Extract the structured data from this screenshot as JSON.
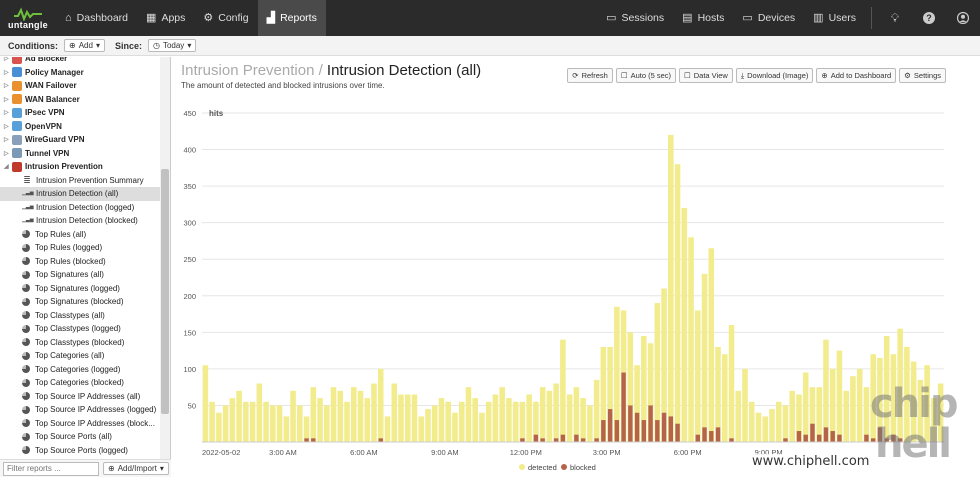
{
  "app": {
    "logo_text": "untangle",
    "nav": [
      {
        "label": "Dashboard",
        "icon": "home-icon"
      },
      {
        "label": "Apps",
        "icon": "grid-icon"
      },
      {
        "label": "Config",
        "icon": "gear-icon"
      },
      {
        "label": "Reports",
        "icon": "chart-icon"
      }
    ],
    "nav_right": [
      {
        "label": "Sessions",
        "icon": "sessions-icon"
      },
      {
        "label": "Hosts",
        "icon": "hosts-icon"
      },
      {
        "label": "Devices",
        "icon": "devices-icon"
      },
      {
        "label": "Users",
        "icon": "users-icon"
      }
    ]
  },
  "conditions": {
    "label": "Conditions:",
    "add_label": "Add",
    "since_label": "Since:",
    "since_value": "Today"
  },
  "sidebar": {
    "apps": [
      {
        "label": "Ad Blocker",
        "color": "#d9534f"
      },
      {
        "label": "Policy Manager",
        "color": "#4a8fd4"
      },
      {
        "label": "WAN Failover",
        "color": "#e8912e"
      },
      {
        "label": "WAN Balancer",
        "color": "#e8912e"
      },
      {
        "label": "IPsec VPN",
        "color": "#5aa0d8"
      },
      {
        "label": "OpenVPN",
        "color": "#5aa0d8"
      },
      {
        "label": "WireGuard VPN",
        "color": "#8aa0b8"
      },
      {
        "label": "Tunnel VPN",
        "color": "#7a9ab8"
      },
      {
        "label": "Intrusion Prevention",
        "color": "#c0392b"
      }
    ],
    "reports": [
      {
        "label": "Intrusion Prevention Summary",
        "kind": "summary"
      },
      {
        "label": "Intrusion Detection (all)",
        "kind": "bar",
        "selected": true
      },
      {
        "label": "Intrusion Detection (logged)",
        "kind": "bar"
      },
      {
        "label": "Intrusion Detection (blocked)",
        "kind": "bar"
      },
      {
        "label": "Top Rules (all)",
        "kind": "pie"
      },
      {
        "label": "Top Rules (logged)",
        "kind": "pie"
      },
      {
        "label": "Top Rules (blocked)",
        "kind": "pie"
      },
      {
        "label": "Top Signatures (all)",
        "kind": "pie"
      },
      {
        "label": "Top Signatures (logged)",
        "kind": "pie"
      },
      {
        "label": "Top Signatures (blocked)",
        "kind": "pie"
      },
      {
        "label": "Top Classtypes (all)",
        "kind": "pie"
      },
      {
        "label": "Top Classtypes (logged)",
        "kind": "pie"
      },
      {
        "label": "Top Classtypes (blocked)",
        "kind": "pie"
      },
      {
        "label": "Top Categories (all)",
        "kind": "pie"
      },
      {
        "label": "Top Categories (logged)",
        "kind": "pie"
      },
      {
        "label": "Top Categories (blocked)",
        "kind": "pie"
      },
      {
        "label": "Top Source IP Addresses (all)",
        "kind": "pie"
      },
      {
        "label": "Top Source IP Addresses (logged)",
        "kind": "pie"
      },
      {
        "label": "Top Source IP Addresses (block...",
        "kind": "pie"
      },
      {
        "label": "Top Source Ports (all)",
        "kind": "pie"
      },
      {
        "label": "Top Source Ports (logged)",
        "kind": "pie"
      }
    ],
    "filter_placeholder": "Filter reports ...",
    "add_import_label": "Add/Import"
  },
  "report": {
    "category": "Intrusion Prevention /",
    "title": "Intrusion Detection (all)",
    "description": "The amount of detected and blocked intrusions over time.",
    "toolbar": [
      {
        "label": "Refresh",
        "icon": "refresh-icon"
      },
      {
        "label": "Auto (5 sec)",
        "icon": "checkbox-icon"
      },
      {
        "label": "Data View",
        "icon": "checkbox-icon"
      },
      {
        "label": "Download (Image)",
        "icon": "download-icon"
      },
      {
        "label": "Add to Dashboard",
        "icon": "plus-circle-icon"
      },
      {
        "label": "Settings",
        "icon": "gear-icon"
      }
    ]
  },
  "chart_data": {
    "type": "bar",
    "stacked": false,
    "ylabel": "hits",
    "ylim": [
      0,
      450
    ],
    "yticks": [
      50,
      100,
      150,
      200,
      250,
      300,
      350,
      400,
      450
    ],
    "xticks": [
      "2022-05-02",
      "3:00 AM",
      "6:00 AM",
      "9:00 AM",
      "12:00 PM",
      "3:00 PM",
      "6:00 PM",
      "9:00 PM"
    ],
    "grid": true,
    "legend_position": "bottom",
    "colors": {
      "detected": "#f2ec8c",
      "blocked": "#b5644a"
    },
    "series": [
      {
        "name": "detected",
        "values": [
          105,
          55,
          40,
          50,
          60,
          70,
          55,
          55,
          80,
          55,
          50,
          50,
          35,
          70,
          50,
          35,
          75,
          60,
          50,
          75,
          70,
          55,
          75,
          70,
          60,
          80,
          100,
          35,
          80,
          65,
          65,
          65,
          35,
          45,
          50,
          60,
          55,
          40,
          55,
          75,
          60,
          40,
          55,
          65,
          75,
          60,
          55,
          55,
          65,
          55,
          75,
          70,
          80,
          140,
          65,
          75,
          60,
          50,
          85,
          130,
          130,
          185,
          180,
          150,
          105,
          145,
          135,
          190,
          210,
          420,
          380,
          320,
          280,
          180,
          230,
          265,
          130,
          120,
          160,
          70,
          100,
          55,
          40,
          35,
          45,
          55,
          50,
          70,
          65,
          95,
          75,
          75,
          140,
          100,
          125,
          70,
          90,
          100,
          75,
          120,
          115,
          145,
          120,
          155,
          130,
          110,
          85,
          105,
          60,
          80
        ]
      },
      {
        "name": "blocked",
        "values": [
          0,
          0,
          0,
          0,
          0,
          0,
          0,
          0,
          0,
          0,
          0,
          0,
          0,
          0,
          0,
          5,
          5,
          0,
          0,
          0,
          0,
          0,
          0,
          0,
          0,
          0,
          5,
          0,
          0,
          0,
          0,
          0,
          0,
          0,
          0,
          0,
          0,
          0,
          0,
          0,
          0,
          0,
          0,
          0,
          0,
          0,
          0,
          5,
          0,
          10,
          5,
          0,
          5,
          10,
          0,
          10,
          5,
          0,
          5,
          30,
          45,
          30,
          95,
          50,
          40,
          30,
          50,
          30,
          40,
          35,
          25,
          0,
          0,
          10,
          20,
          15,
          20,
          0,
          5,
          0,
          0,
          0,
          0,
          0,
          0,
          0,
          5,
          0,
          15,
          10,
          25,
          10,
          20,
          15,
          10,
          0,
          0,
          0,
          10,
          5,
          20,
          5,
          10,
          5,
          0,
          0,
          0,
          0,
          0,
          0
        ]
      }
    ]
  },
  "watermark": {
    "big_text": "chip hell",
    "url": "www.chiphell.com"
  }
}
